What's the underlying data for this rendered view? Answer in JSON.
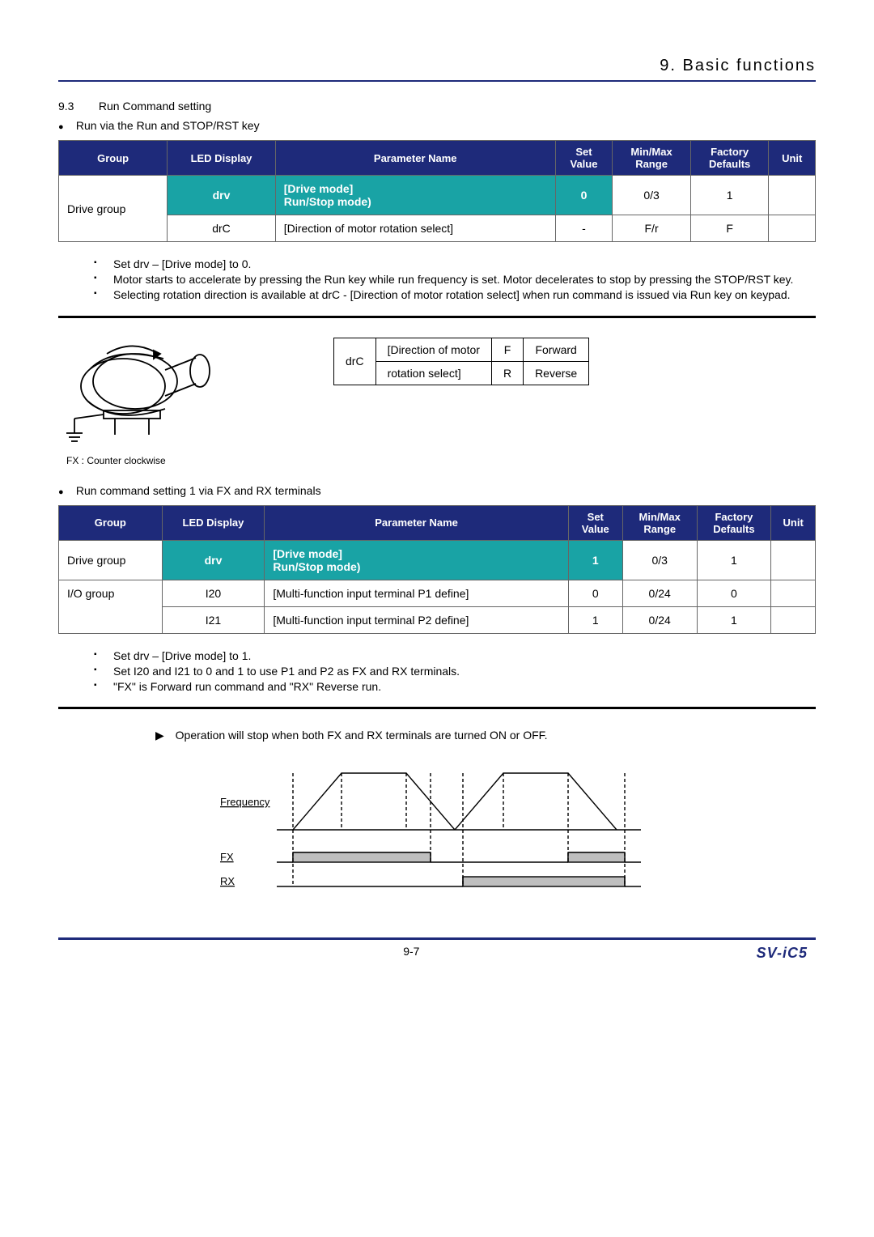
{
  "header": {
    "title": "9. Basic functions"
  },
  "section": {
    "num": "9.3",
    "title": "Run Command setting"
  },
  "bullet1": "Run via the Run and STOP/RST key",
  "table1": {
    "headers": [
      "Group",
      "LED Display",
      "Parameter Name",
      "Set\nValue",
      "Min/Max\nRange",
      "Factory\nDefaults",
      "Unit"
    ],
    "rows": [
      {
        "group": "Drive group",
        "led": "drv",
        "param": "[Drive mode]\nRun/Stop mode)",
        "set": "0",
        "range": "0/3",
        "def": "1",
        "unit": "",
        "hl": true
      },
      {
        "group": "",
        "led": "drC",
        "param": "[Direction of motor rotation select]",
        "set": "-",
        "range": "F/r",
        "def": "F",
        "unit": "",
        "hl": false
      }
    ]
  },
  "notes1": [
    "Set drv – [Drive mode] to 0.",
    "Motor starts to accelerate by pressing the Run key while run frequency is set. Motor decelerates to stop by pressing the STOP/RST key.",
    "Selecting rotation direction is available at drC - [Direction of motor rotation select] when run command is issued via Run key on keypad."
  ],
  "motor_caption": "FX : Counter clockwise",
  "drc_table": {
    "r1": {
      "c1": "drC",
      "c2": "[Direction of motor",
      "c3": "F",
      "c4": "Forward"
    },
    "r2": {
      "c1": "",
      "c2": "rotation select]",
      "c3": "R",
      "c4": "Reverse"
    }
  },
  "bullet2": "Run command setting 1 via FX and RX terminals",
  "table2": {
    "headers": [
      "Group",
      "LED Display",
      "Parameter Name",
      "Set\nValue",
      "Min/Max\nRange",
      "Factory\nDefaults",
      "Unit"
    ],
    "rows": [
      {
        "group": "Drive group",
        "led": "drv",
        "param": "[Drive mode]\nRun/Stop mode)",
        "set": "1",
        "range": "0/3",
        "def": "1",
        "unit": "",
        "hl": true
      },
      {
        "group": "I/O group",
        "led": "I20",
        "param": "[Multi-function input terminal P1 define]",
        "set": "0",
        "range": "0/24",
        "def": "0",
        "unit": "",
        "hl": false
      },
      {
        "group": "",
        "led": "I21",
        "param": "[Multi-function input terminal P2 define]",
        "set": "1",
        "range": "0/24",
        "def": "1",
        "unit": "",
        "hl": false
      }
    ]
  },
  "notes2": [
    "Set drv – [Drive mode] to 1.",
    "Set I20 and I21 to 0 and 1 to use P1 and P2 as FX and RX terminals.",
    "\"FX\" is Forward run command and \"RX\" Reverse run."
  ],
  "op_note": "Operation will stop when both FX and RX terminals are turned ON or OFF.",
  "timing": {
    "freq": "Frequency",
    "fx": "FX",
    "rx": "RX"
  },
  "footer": {
    "page": "9-7",
    "model": "SV-iC5"
  }
}
